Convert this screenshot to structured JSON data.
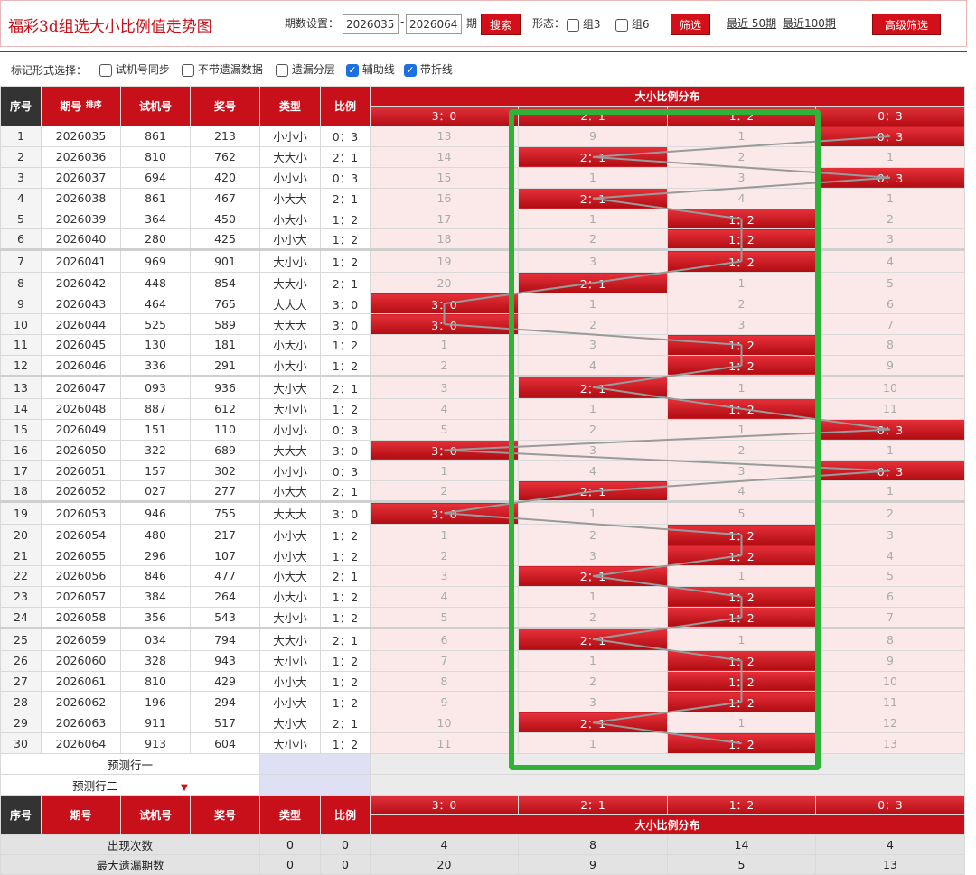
{
  "header": {
    "title": "福彩3d组选大小比例值走势图",
    "period_label": "期数设置：",
    "period_from": "2026035",
    "period_sep": "-",
    "period_to": "2026064",
    "period_unit": "期",
    "search_label": "搜索",
    "shape_label": "形态：",
    "group3_label": "组3",
    "group6_label": "组6",
    "filter_label": "筛选",
    "recent50_label": "最近 50期",
    "recent100_label": "最近100期",
    "advanced_label": "高级筛选"
  },
  "markbar": {
    "label": "标记形式选择：",
    "options": [
      {
        "label": "试机号同步",
        "checked": false
      },
      {
        "label": "不带遗漏数据",
        "checked": false
      },
      {
        "label": "遗漏分层",
        "checked": false
      },
      {
        "label": "辅助线",
        "checked": true
      },
      {
        "label": "带折线",
        "checked": true
      }
    ],
    "check_glyph": "✓"
  },
  "columns": {
    "seq": "序号",
    "period": "期号",
    "sort": "排序",
    "trial": "试机号",
    "prize": "奖号",
    "type": "类型",
    "ratio": "比例",
    "dist": "大小比例分布",
    "dist_labels": [
      "3：0",
      "2：1",
      "1：2",
      "0：3"
    ]
  },
  "rows": [
    {
      "seq": "1",
      "period": "2026035",
      "trial": "861",
      "prize": "213",
      "type": "小小小",
      "ratio": "0：3",
      "dist": [
        "13",
        "9",
        "1",
        "0：3"
      ],
      "hit": 3
    },
    {
      "seq": "2",
      "period": "2026036",
      "trial": "810",
      "prize": "762",
      "type": "大大小",
      "ratio": "2：1",
      "dist": [
        "14",
        "2：1",
        "2",
        "1"
      ],
      "hit": 1
    },
    {
      "seq": "3",
      "period": "2026037",
      "trial": "694",
      "prize": "420",
      "type": "小小小",
      "ratio": "0：3",
      "dist": [
        "15",
        "1",
        "3",
        "0：3"
      ],
      "hit": 3
    },
    {
      "seq": "4",
      "period": "2026038",
      "trial": "861",
      "prize": "467",
      "type": "小大大",
      "ratio": "2：1",
      "dist": [
        "16",
        "2：1",
        "4",
        "1"
      ],
      "hit": 1
    },
    {
      "seq": "5",
      "period": "2026039",
      "trial": "364",
      "prize": "450",
      "type": "小大小",
      "ratio": "1：2",
      "dist": [
        "17",
        "1",
        "1：2",
        "2"
      ],
      "hit": 2
    },
    {
      "seq": "6",
      "period": "2026040",
      "trial": "280",
      "prize": "425",
      "type": "小小大",
      "ratio": "1：2",
      "dist": [
        "18",
        "2",
        "1：2",
        "3"
      ],
      "hit": 2
    },
    {
      "seq": "7",
      "period": "2026041",
      "trial": "969",
      "prize": "901",
      "type": "大小小",
      "ratio": "1：2",
      "dist": [
        "19",
        "3",
        "1：2",
        "4"
      ],
      "hit": 2
    },
    {
      "seq": "8",
      "period": "2026042",
      "trial": "448",
      "prize": "854",
      "type": "大大小",
      "ratio": "2：1",
      "dist": [
        "20",
        "2：1",
        "1",
        "5"
      ],
      "hit": 1
    },
    {
      "seq": "9",
      "period": "2026043",
      "trial": "464",
      "prize": "765",
      "type": "大大大",
      "ratio": "3：0",
      "dist": [
        "3：0",
        "1",
        "2",
        "6"
      ],
      "hit": 0
    },
    {
      "seq": "10",
      "period": "2026044",
      "trial": "525",
      "prize": "589",
      "type": "大大大",
      "ratio": "3：0",
      "dist": [
        "3：0",
        "2",
        "3",
        "7"
      ],
      "hit": 0
    },
    {
      "seq": "11",
      "period": "2026045",
      "trial": "130",
      "prize": "181",
      "type": "小大小",
      "ratio": "1：2",
      "dist": [
        "1",
        "3",
        "1：2",
        "8"
      ],
      "hit": 2
    },
    {
      "seq": "12",
      "period": "2026046",
      "trial": "336",
      "prize": "291",
      "type": "小大小",
      "ratio": "1：2",
      "dist": [
        "2",
        "4",
        "1：2",
        "9"
      ],
      "hit": 2
    },
    {
      "seq": "13",
      "period": "2026047",
      "trial": "093",
      "prize": "936",
      "type": "大小大",
      "ratio": "2：1",
      "dist": [
        "3",
        "2：1",
        "1",
        "10"
      ],
      "hit": 1
    },
    {
      "seq": "14",
      "period": "2026048",
      "trial": "887",
      "prize": "612",
      "type": "大小小",
      "ratio": "1：2",
      "dist": [
        "4",
        "1",
        "1：2",
        "11"
      ],
      "hit": 2
    },
    {
      "seq": "15",
      "period": "2026049",
      "trial": "151",
      "prize": "110",
      "type": "小小小",
      "ratio": "0：3",
      "dist": [
        "5",
        "2",
        "1",
        "0：3"
      ],
      "hit": 3
    },
    {
      "seq": "16",
      "period": "2026050",
      "trial": "322",
      "prize": "689",
      "type": "大大大",
      "ratio": "3：0",
      "dist": [
        "3：0",
        "3",
        "2",
        "1"
      ],
      "hit": 0
    },
    {
      "seq": "17",
      "period": "2026051",
      "trial": "157",
      "prize": "302",
      "type": "小小小",
      "ratio": "0：3",
      "dist": [
        "1",
        "4",
        "3",
        "0：3"
      ],
      "hit": 3
    },
    {
      "seq": "18",
      "period": "2026052",
      "trial": "027",
      "prize": "277",
      "type": "小大大",
      "ratio": "2：1",
      "dist": [
        "2",
        "2：1",
        "4",
        "1"
      ],
      "hit": 1
    },
    {
      "seq": "19",
      "period": "2026053",
      "trial": "946",
      "prize": "755",
      "type": "大大大",
      "ratio": "3：0",
      "dist": [
        "3：0",
        "1",
        "5",
        "2"
      ],
      "hit": 0
    },
    {
      "seq": "20",
      "period": "2026054",
      "trial": "480",
      "prize": "217",
      "type": "小小大",
      "ratio": "1：2",
      "dist": [
        "1",
        "2",
        "1：2",
        "3"
      ],
      "hit": 2
    },
    {
      "seq": "21",
      "period": "2026055",
      "trial": "296",
      "prize": "107",
      "type": "小小大",
      "ratio": "1：2",
      "dist": [
        "2",
        "3",
        "1：2",
        "4"
      ],
      "hit": 2
    },
    {
      "seq": "22",
      "period": "2026056",
      "trial": "846",
      "prize": "477",
      "type": "小大大",
      "ratio": "2：1",
      "dist": [
        "3",
        "2：1",
        "1",
        "5"
      ],
      "hit": 1
    },
    {
      "seq": "23",
      "period": "2026057",
      "trial": "384",
      "prize": "264",
      "type": "小大小",
      "ratio": "1：2",
      "dist": [
        "4",
        "1",
        "1：2",
        "6"
      ],
      "hit": 2
    },
    {
      "seq": "24",
      "period": "2026058",
      "trial": "356",
      "prize": "543",
      "type": "大小小",
      "ratio": "1：2",
      "dist": [
        "5",
        "2",
        "1：2",
        "7"
      ],
      "hit": 2
    },
    {
      "seq": "25",
      "period": "2026059",
      "trial": "034",
      "prize": "794",
      "type": "大大小",
      "ratio": "2：1",
      "dist": [
        "6",
        "2：1",
        "1",
        "8"
      ],
      "hit": 1
    },
    {
      "seq": "26",
      "period": "2026060",
      "trial": "328",
      "prize": "943",
      "type": "大小小",
      "ratio": "1：2",
      "dist": [
        "7",
        "1",
        "1：2",
        "9"
      ],
      "hit": 2
    },
    {
      "seq": "27",
      "period": "2026061",
      "trial": "810",
      "prize": "429",
      "type": "小小大",
      "ratio": "1：2",
      "dist": [
        "8",
        "2",
        "1：2",
        "10"
      ],
      "hit": 2
    },
    {
      "seq": "28",
      "period": "2026062",
      "trial": "196",
      "prize": "294",
      "type": "小小大",
      "ratio": "1：2",
      "dist": [
        "9",
        "3",
        "1：2",
        "11"
      ],
      "hit": 2
    },
    {
      "seq": "29",
      "period": "2026063",
      "trial": "911",
      "prize": "517",
      "type": "大小大",
      "ratio": "2：1",
      "dist": [
        "10",
        "2：1",
        "1",
        "12"
      ],
      "hit": 1
    },
    {
      "seq": "30",
      "period": "2026064",
      "trial": "913",
      "prize": "604",
      "type": "大小小",
      "ratio": "1：2",
      "dist": [
        "11",
        "1",
        "1：2",
        "13"
      ],
      "hit": 2
    }
  ],
  "predict": {
    "row1": "预测行一",
    "row2": "预测行二"
  },
  "stats": [
    {
      "label": "出现次数",
      "type": "0",
      "ratio": "0",
      "dist": [
        "4",
        "8",
        "14",
        "4"
      ]
    },
    {
      "label": "最大遗漏期数",
      "type": "0",
      "ratio": "0",
      "dist": [
        "20",
        "9",
        "5",
        "13"
      ]
    }
  ],
  "colors": {
    "brand_red": "#c8101a",
    "highlight_green": "#2fb23a",
    "pink_row": "#fbe9ea"
  }
}
